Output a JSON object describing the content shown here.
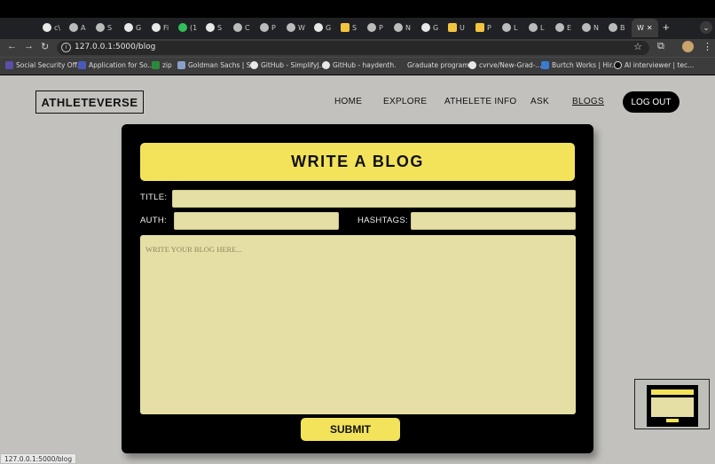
{
  "browser": {
    "tabs": [
      {
        "icon": "github-icon",
        "label": "c\\"
      },
      {
        "icon": "globe-icon",
        "label": "A"
      },
      {
        "icon": "globe-icon",
        "label": "S"
      },
      {
        "icon": "github-icon",
        "label": "G"
      },
      {
        "icon": "github-icon",
        "label": "Fi"
      },
      {
        "icon": "whatsapp-icon",
        "label": "(1"
      },
      {
        "icon": "google-icon",
        "label": "S"
      },
      {
        "icon": "globe-icon",
        "label": "C"
      },
      {
        "icon": "mail-icon",
        "label": "P"
      },
      {
        "icon": "globe-icon",
        "label": "W"
      },
      {
        "icon": "google-icon",
        "label": "G"
      },
      {
        "icon": "folder-icon",
        "label": "S"
      },
      {
        "icon": "mail-icon",
        "label": "P"
      },
      {
        "icon": "globe-icon",
        "label": "N"
      },
      {
        "icon": "google-icon",
        "label": "G"
      },
      {
        "icon": "folder-icon",
        "label": "U"
      },
      {
        "icon": "folder-icon",
        "label": "P"
      },
      {
        "icon": "globe-icon",
        "label": "L"
      },
      {
        "icon": "globe-icon",
        "label": "L"
      },
      {
        "icon": "globe-icon",
        "label": "E"
      },
      {
        "icon": "globe-icon",
        "label": "N"
      },
      {
        "icon": "globe-icon",
        "label": "B"
      }
    ],
    "active_tab": {
      "label": "W",
      "close": "✕"
    },
    "new_tab": "+",
    "tab_menu": "⌄",
    "url": "127.0.0.1:5000/blog",
    "bookmarks": [
      "Social Security Off...",
      "Application for So...",
      "zip",
      "Goldman Sachs | S...",
      "GitHub - SimplifyJ...",
      "GitHub - haydenth...",
      "Graduate program...",
      "cvrve/New-Grad-...",
      "Burtch Works | Hir...",
      "AI interviewer | tec..."
    ],
    "status_url": "127.0.0.1:5000/blog"
  },
  "site": {
    "brand": "ATHLETEVERSE",
    "nav": {
      "home": "HOME",
      "explore": "EXPLORE",
      "athlete_info": "ATHELETE INFO",
      "ask": "ASK",
      "blogs": "BLOGS"
    },
    "logout": "LOG OUT"
  },
  "form": {
    "heading": "WRITE A BLOG",
    "title_label": "TITLE:",
    "author_label": "AUTH:",
    "hashtags_label": "HASHTAGS:",
    "title_value": "",
    "author_value": "",
    "hashtags_value": "",
    "body_placeholder": "WRITE YOUR BLOG HERE...",
    "submit": "SUBMIT"
  },
  "colors": {
    "accent_yellow": "#f3e35a",
    "field_fill": "#e5dfa5",
    "page_bg": "#c2c1bd",
    "panel_bg": "#000000"
  }
}
